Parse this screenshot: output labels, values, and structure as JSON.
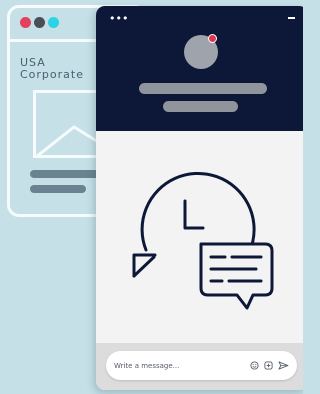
{
  "colors": {
    "page_bg": "#c6e0e7",
    "window_outline": "#f7fbfd",
    "header_bg": "#0d1838",
    "body_bg": "#f3f3f3",
    "footer_bg": "#dcdcdc",
    "placeholder_bar": "#8f949d",
    "status_dot": "#e0364f",
    "icon_stroke": "#0d1838",
    "dot_red": "#e4405e",
    "dot_gray": "#4a4f57",
    "dot_cyan": "#2bd3e4"
  },
  "background_window": {
    "company_name": "USA\nCorporate",
    "image_icon": "image-placeholder-icon"
  },
  "chat_widget": {
    "menu_icon": "ellipsis-icon",
    "menu_glyph": "•••",
    "minimize_icon": "minimize-icon",
    "avatar": "agent-avatar",
    "illustration": "chat-history-icon",
    "input": {
      "placeholder": "Write a message..."
    },
    "input_icons": [
      "emoji-icon",
      "attachment-icon",
      "send-icon"
    ]
  }
}
